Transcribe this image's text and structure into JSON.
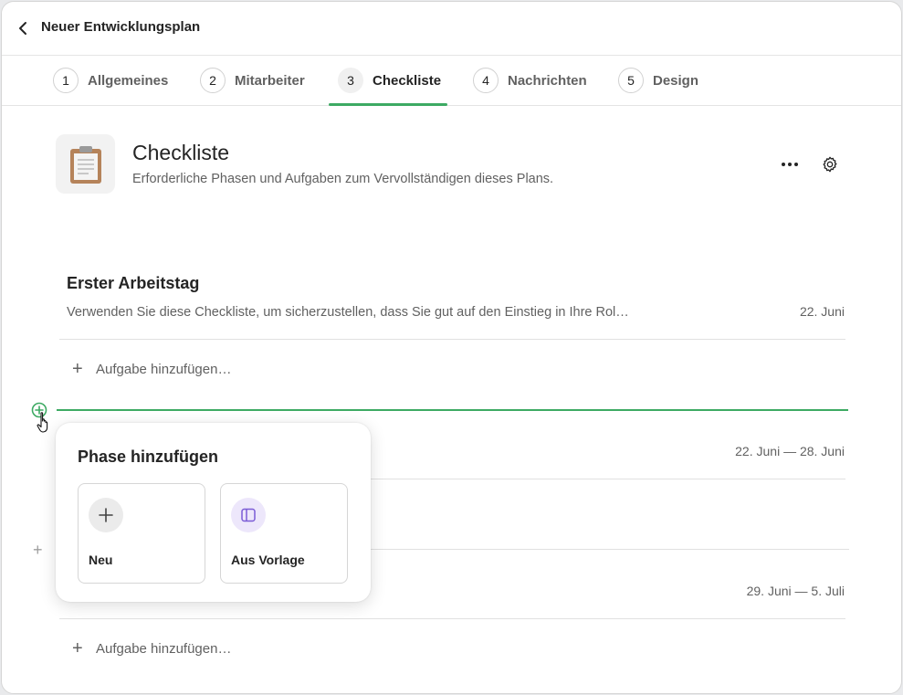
{
  "header": {
    "title": "Neuer Entwicklungsplan"
  },
  "tabs": [
    {
      "num": "1",
      "label": "Allgemeines"
    },
    {
      "num": "2",
      "label": "Mitarbeiter"
    },
    {
      "num": "3",
      "label": "Checkliste"
    },
    {
      "num": "4",
      "label": "Nachrichten"
    },
    {
      "num": "5",
      "label": "Design"
    }
  ],
  "active_tab": "Checkliste",
  "section": {
    "title": "Checkliste",
    "subtitle": "Erforderliche Phasen und Aufgaben zum Vervollständigen dieses Plans."
  },
  "phases": [
    {
      "title": "Erster Arbeitstag",
      "description": "Verwenden Sie diese Checkliste, um sicherzustellen, dass Sie gut auf den Einstieg in Ihre Rol…",
      "date": "22. Juni",
      "add_task": "Aufgabe hinzufügen…"
    },
    {
      "date": "22. Juni — 28. Juni"
    },
    {
      "date": "29. Juni — 5. Juli",
      "add_task": "Aufgabe hinzufügen…"
    }
  ],
  "popover": {
    "title": "Phase hinzufügen",
    "options": [
      {
        "label": "Neu",
        "icon": "plus-icon"
      },
      {
        "label": "Aus Vorlage",
        "icon": "template-icon"
      }
    ]
  },
  "colors": {
    "accent": "#3daa63",
    "template_icon_bg": "#ede7fb",
    "template_icon": "#7b5cd6"
  }
}
